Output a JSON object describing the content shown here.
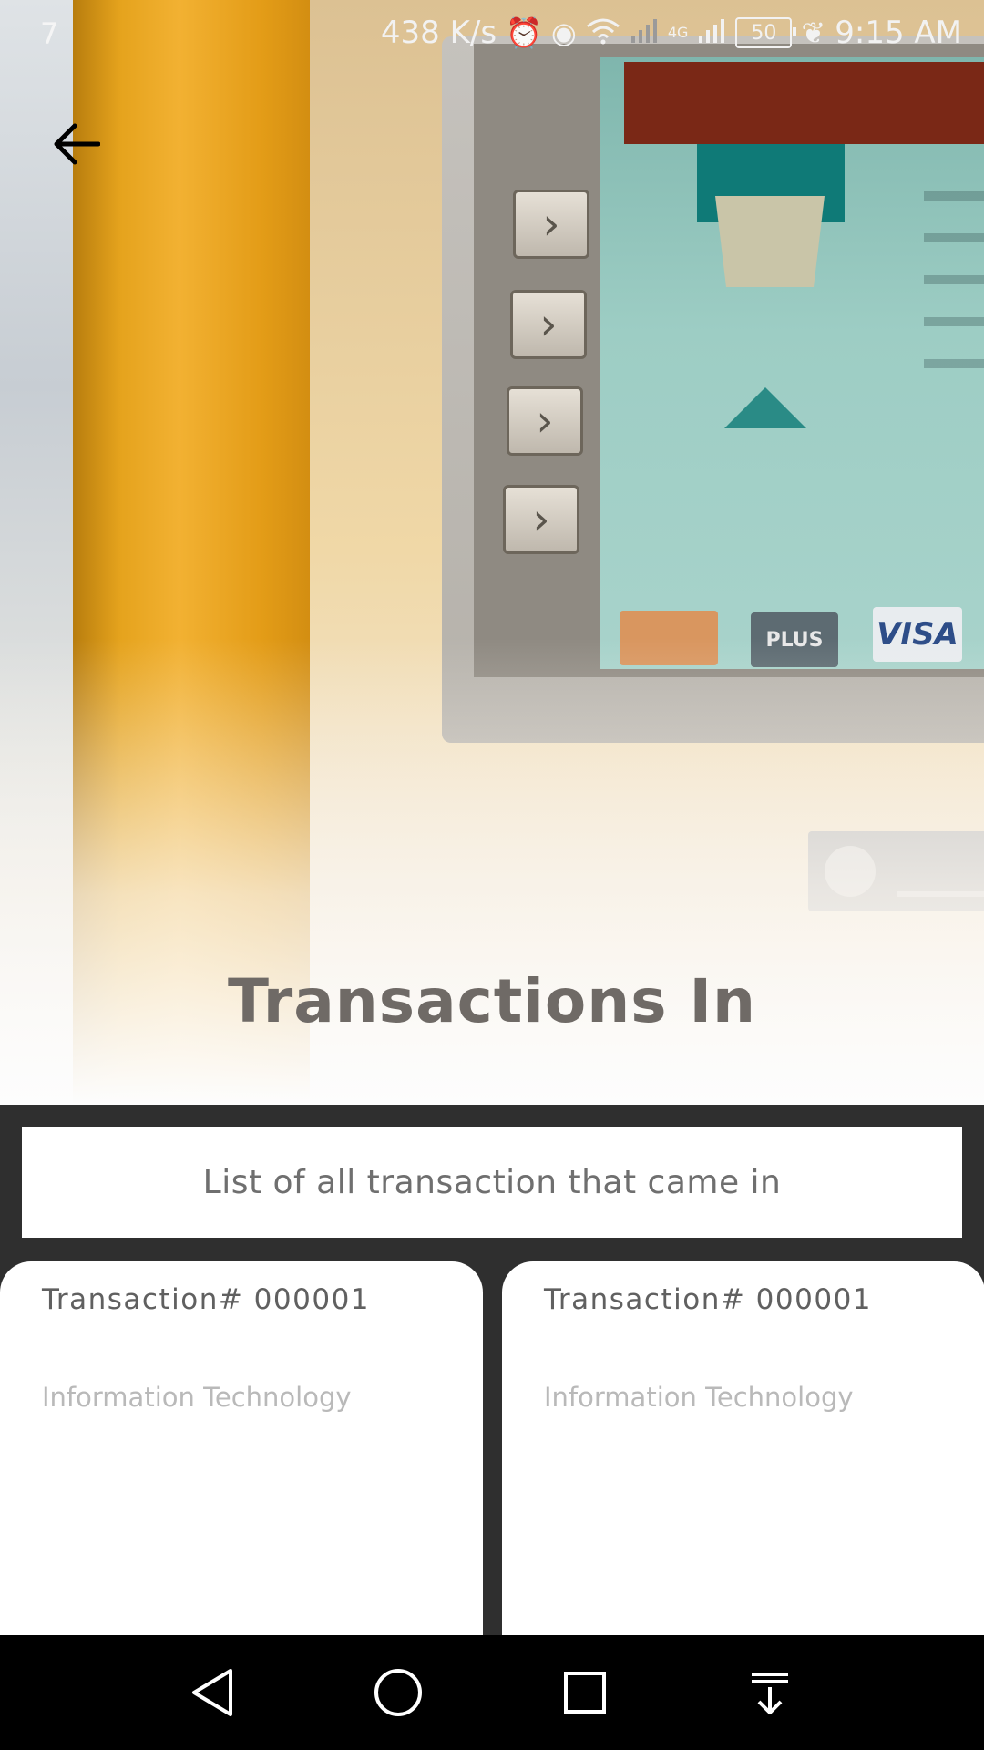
{
  "status_bar": {
    "left_indicator": "7",
    "network_speed": "438 K/s",
    "battery_level": "50",
    "time": "9:15 AM",
    "icons": [
      "alarm-icon",
      "eye-comfort-icon",
      "wifi-icon",
      "signal-off-icon",
      "4g-icon",
      "signal-icon",
      "battery-icon",
      "leaf-icon"
    ]
  },
  "header": {
    "back_icon": "arrow-left-icon",
    "title": "Transactions In"
  },
  "banner": {
    "subtitle": "List of all transaction that came in"
  },
  "transactions": [
    {
      "title": "Transaction# 000001",
      "department": "Information Technology"
    },
    {
      "title": "Transaction# 000001",
      "department": "Information Technology"
    }
  ],
  "hero_image": {
    "atm_logos": [
      "",
      "PLUS",
      "VISA"
    ]
  },
  "nav_bar": {
    "buttons": [
      "back-triangle-icon",
      "home-circle-icon",
      "recents-square-icon",
      "notification-pull-icon"
    ]
  },
  "colors": {
    "page_background": "#2f2f2f",
    "card_background": "#ffffff",
    "title_text": "#6f6a66",
    "secondary_text": "#b9b9b9"
  }
}
